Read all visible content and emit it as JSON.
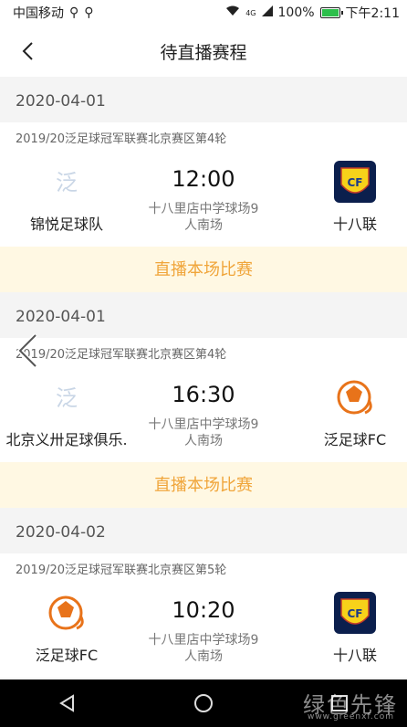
{
  "status_bar": {
    "carrier": "中国移动",
    "signal_label": "4G",
    "battery": "100%",
    "time": "下午2:11"
  },
  "header": {
    "title": "待直播赛程"
  },
  "matches": [
    {
      "date": "2020-04-01",
      "league": "2019/20泛足球冠军联赛北京赛区第4轮",
      "home": "锦悦足球队",
      "away": "十八联",
      "time": "12:00",
      "venue_line1": "十八里店中学球场9",
      "venue_line2": "人南场",
      "live_label": "直播本场比赛"
    },
    {
      "date": "2020-04-01",
      "league": "2019/20泛足球冠军联赛北京赛区第4轮",
      "home": "北京义卅足球俱乐.",
      "away": "泛足球FC",
      "time": "16:30",
      "venue_line1": "十八里店中学球场9",
      "venue_line2": "人南场",
      "live_label": "直播本场比赛"
    },
    {
      "date": "2020-04-02",
      "league": "2019/20泛足球冠军联赛北京赛区第5轮",
      "home": "泛足球FC",
      "away": "十八联",
      "time": "10:20",
      "venue_line1": "十八里店中学球场9",
      "venue_line2": "人南场"
    }
  ],
  "watermark": {
    "brand": "绿色先锋",
    "url": "www.greenxf.com"
  },
  "colors": {
    "accent": "#f0a53a",
    "live_bg": "#fff8e3",
    "bg": "#f4f4f4"
  }
}
